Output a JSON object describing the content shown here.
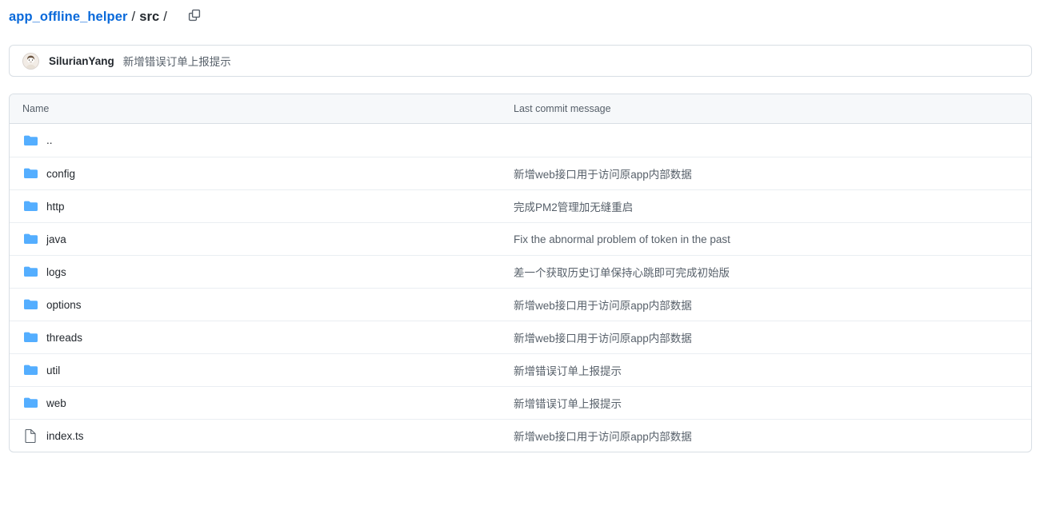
{
  "breadcrumb": {
    "repo_label": "app_offline_helper",
    "separator": "/",
    "current_label": "src",
    "trailing_separator": "/",
    "copy_icon_name": "copy-path-icon"
  },
  "latest_commit": {
    "author": "SilurianYang",
    "message": "新增错误订单上报提示"
  },
  "table": {
    "headers": {
      "name": "Name",
      "last_commit_message": "Last commit message"
    },
    "rows": [
      {
        "name": "..",
        "type": "directory",
        "message": ""
      },
      {
        "name": "config",
        "type": "directory",
        "message": "新增web接口用于访问原app内部数据"
      },
      {
        "name": "http",
        "type": "directory",
        "message": "完成PM2管理加无缝重启"
      },
      {
        "name": "java",
        "type": "directory",
        "message": "Fix the abnormal problem of token in the past"
      },
      {
        "name": "logs",
        "type": "directory",
        "message": "差一个获取历史订单保持心跳即可完成初始版"
      },
      {
        "name": "options",
        "type": "directory",
        "message": "新增web接口用于访问原app内部数据"
      },
      {
        "name": "threads",
        "type": "directory",
        "message": "新增web接口用于访问原app内部数据"
      },
      {
        "name": "util",
        "type": "directory",
        "message": "新增错误订单上报提示"
      },
      {
        "name": "web",
        "type": "directory",
        "message": "新增错误订单上报提示"
      },
      {
        "name": "index.ts",
        "type": "file",
        "message": "新增web接口用于访问原app内部数据"
      }
    ]
  },
  "colors": {
    "link_blue": "#0969da",
    "folder_blue": "#54aeff",
    "file_gray": "#57606a",
    "border": "#d8dee4",
    "row_border": "#eaeef2",
    "header_bg": "#f6f8fa",
    "text_primary": "#24292f",
    "text_muted": "#57606a"
  }
}
